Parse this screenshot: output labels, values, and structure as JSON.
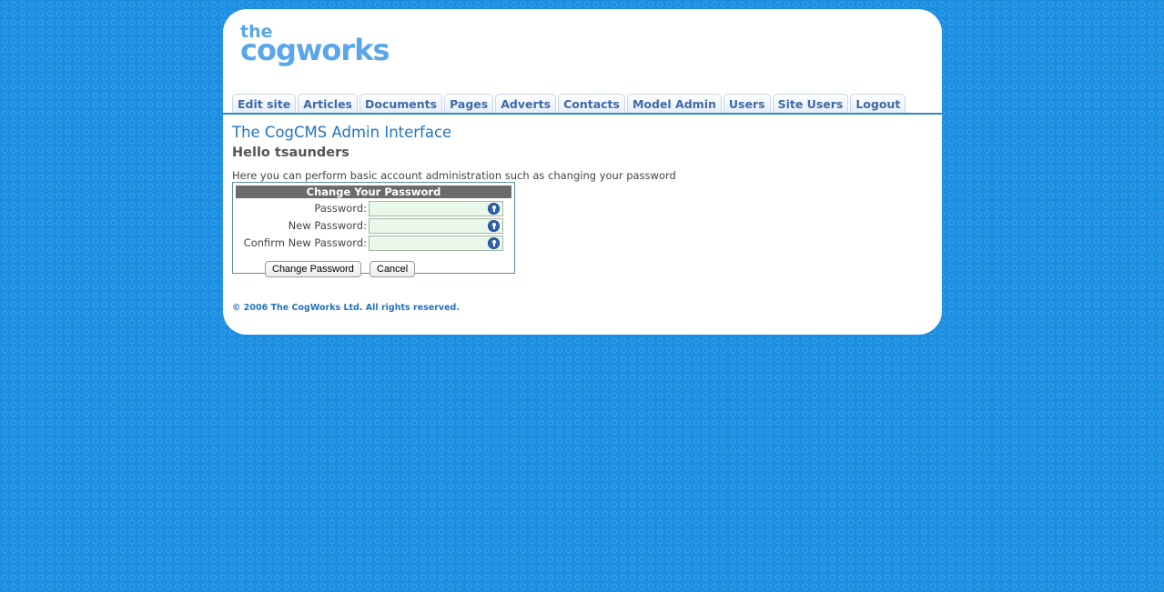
{
  "logo": {
    "line1": "the",
    "line2": "cogworks"
  },
  "nav": {
    "tabs": [
      {
        "label": "Edit site"
      },
      {
        "label": "Articles"
      },
      {
        "label": "Documents"
      },
      {
        "label": "Pages"
      },
      {
        "label": "Adverts"
      },
      {
        "label": "Contacts"
      },
      {
        "label": "Model Admin"
      },
      {
        "label": "Users"
      },
      {
        "label": "Site Users"
      },
      {
        "label": "Logout"
      }
    ]
  },
  "main": {
    "title": "The CogCMS Admin Interface",
    "greeting": "Hello tsaunders",
    "description": "Here you can perform basic account administration such as changing your password"
  },
  "form": {
    "heading": "Change Your Password",
    "fields": [
      {
        "label": "Password:",
        "value": ""
      },
      {
        "label": "New Password:",
        "value": ""
      },
      {
        "label": "Confirm New Password:",
        "value": ""
      }
    ],
    "submit_label": "Change Password",
    "cancel_label": "Cancel"
  },
  "footer": {
    "copyright": "© 2006 The CogWorks Ltd. All rights reserved."
  },
  "colors": {
    "background": "#1a8ee0",
    "accent": "#2273c4",
    "tab_text": "#3f6aa8",
    "input_bg": "#e9f8e8"
  },
  "icons": {
    "field_icon": "keyhole-icon"
  }
}
